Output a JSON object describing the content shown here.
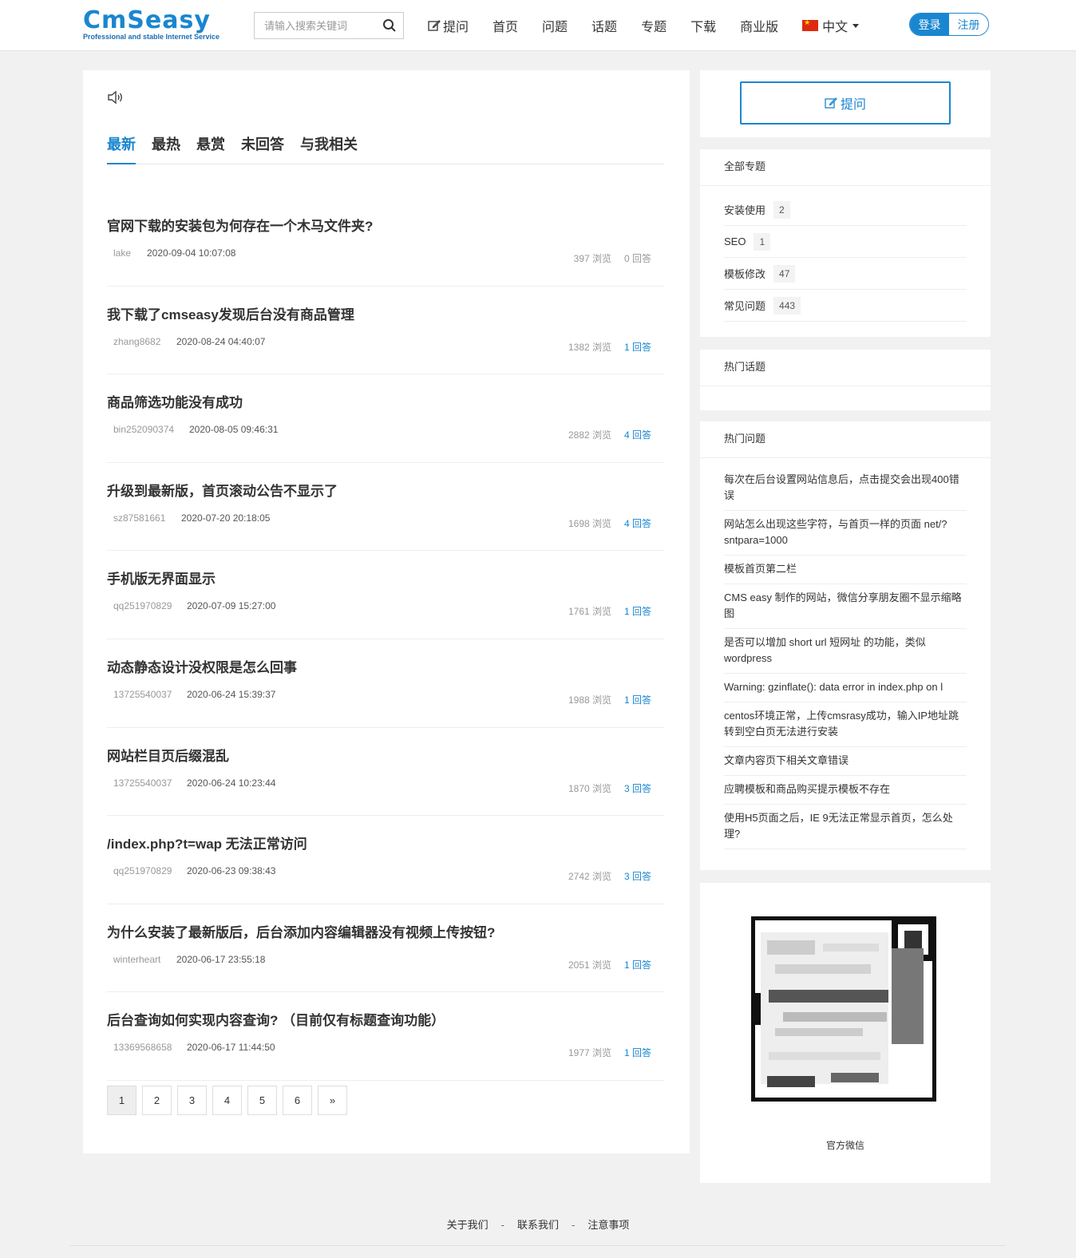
{
  "header": {
    "logo_text": "CmSeasy",
    "logo_tagline": "Professional and stable Internet Service",
    "search_placeholder": "请输入搜索关键词",
    "nav": [
      {
        "label": "提问"
      },
      {
        "label": "首页"
      },
      {
        "label": "问题"
      },
      {
        "label": "话题"
      },
      {
        "label": "专题"
      },
      {
        "label": "下载"
      },
      {
        "label": "商业版"
      }
    ],
    "language": "中文",
    "login": "登录",
    "register": "注册"
  },
  "tabs": [
    "最新",
    "最热",
    "悬赏",
    "未回答",
    "与我相关"
  ],
  "active_tab": "最新",
  "questions": [
    {
      "title": "官网下载的安装包为何存在一个木马文件夹?",
      "user": "lake",
      "time": "2020-09-04 10:07:08",
      "views": "397 浏览",
      "answers": "0 回答"
    },
    {
      "title": "我下载了cmseasy发现后台没有商品管理",
      "user": "zhang8682",
      "time": "2020-08-24 04:40:07",
      "views": "1382 浏览",
      "answers": "1 回答"
    },
    {
      "title": "商品筛选功能没有成功",
      "user": "bin252090374",
      "time": "2020-08-05 09:46:31",
      "views": "2882 浏览",
      "answers": "4 回答"
    },
    {
      "title": "升级到最新版，首页滚动公告不显示了",
      "user": "sz87581661",
      "time": "2020-07-20 20:18:05",
      "views": "1698 浏览",
      "answers": "4 回答"
    },
    {
      "title": "手机版无界面显示",
      "user": "qq251970829",
      "time": "2020-07-09 15:27:00",
      "views": "1761 浏览",
      "answers": "1 回答"
    },
    {
      "title": "动态静态设计没权限是怎么回事",
      "user": "13725540037",
      "time": "2020-06-24 15:39:37",
      "views": "1988 浏览",
      "answers": "1 回答"
    },
    {
      "title": "网站栏目页后缀混乱",
      "user": "13725540037",
      "time": "2020-06-24 10:23:44",
      "views": "1870 浏览",
      "answers": "3 回答"
    },
    {
      "title": "/index.php?t=wap 无法正常访问",
      "user": "qq251970829",
      "time": "2020-06-23 09:38:43",
      "views": "2742 浏览",
      "answers": "3 回答"
    },
    {
      "title": "为什么安装了最新版后，后台添加内容编辑器没有视频上传按钮?",
      "user": "winterheart",
      "time": "2020-06-17 23:55:18",
      "views": "2051 浏览",
      "answers": "1 回答"
    },
    {
      "title": "后台查询如何实现内容查询? （目前仅有标题查询功能）",
      "user": "13369568658",
      "time": "2020-06-17 11:44:50",
      "views": "1977 浏览",
      "answers": "1 回答"
    }
  ],
  "pagination": [
    "1",
    "2",
    "3",
    "4",
    "5",
    "6",
    "»"
  ],
  "current_page": "1",
  "sidebar": {
    "ask_button": "提问",
    "topics_title": "全部专题",
    "topics": [
      {
        "name": "安装使用",
        "count": "2"
      },
      {
        "name": "SEO",
        "count": "1"
      },
      {
        "name": "模板修改",
        "count": "47"
      },
      {
        "name": "常见问题",
        "count": "443"
      }
    ],
    "hot_topics_title": "热门话题",
    "hot_questions_title": "热门问题",
    "hot_questions": [
      "每次在后台设置网站信息后，点击提交会出现400错误",
      "网站怎么出现这些字符，与首页一样的页面 net/?sntpara=1000",
      "模板首页第二栏",
      "CMS easy 制作的网站，微信分享朋友圈不显示缩略图",
      "是否可以增加 short url 短网址 的功能，类似wordpress",
      "Warning: gzinflate(): data error in index.php on l",
      "centos环境正常，上传cmsrasy成功，输入IP地址跳转到空白页无法进行安装",
      "文章内容页下相关文章错误",
      "应聘模板和商品购买提示模板不存在",
      "使用H5页面之后，IE 9无法正常显示首页，怎么处理?"
    ],
    "qr_label": "官方微信"
  },
  "footer": {
    "links": [
      "关于我们",
      "联系我们",
      "注意事项"
    ]
  },
  "colors": {
    "accent": "#1a86d0",
    "background": "#f1f1f1"
  }
}
